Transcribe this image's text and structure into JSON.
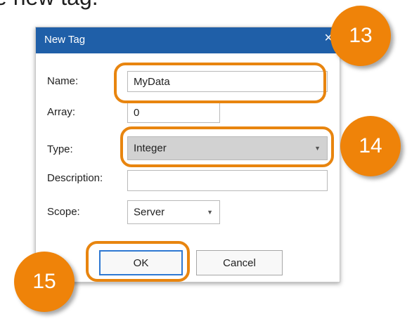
{
  "background": {
    "instruction_fragment": "e new tag."
  },
  "dialog": {
    "title": "New Tag",
    "close_glyph": "×",
    "fields": {
      "name": {
        "label": "Name:",
        "value": "MyData"
      },
      "array": {
        "label": "Array:",
        "value": "0"
      },
      "type": {
        "label": "Type:",
        "value": "Integer"
      },
      "description": {
        "label": "Description:",
        "value": ""
      },
      "scope": {
        "label": "Scope:",
        "value": "Server"
      }
    },
    "buttons": {
      "ok": "OK",
      "cancel": "Cancel"
    }
  },
  "callouts": {
    "step_1": "13",
    "step_2": "14",
    "step_3": "15"
  },
  "colors": {
    "titlebar": "#1f5fa8",
    "callout": "#ef8309",
    "highlight": "#e8850f",
    "dialog_bg": "#efefef"
  },
  "icons": {
    "close": "close-icon",
    "dropdown": "chevron-down-icon"
  }
}
